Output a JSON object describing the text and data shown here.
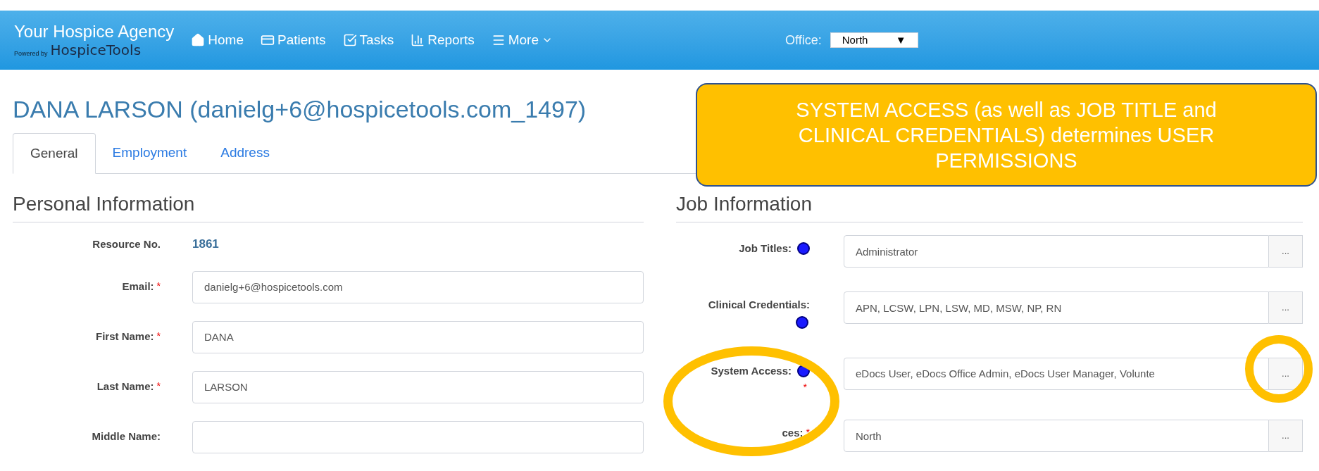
{
  "navbar": {
    "brand": "Your Hospice Agency",
    "powered_by": "Powered by",
    "logo_text": "HospiceTools",
    "items": [
      {
        "label": "Home"
      },
      {
        "label": "Patients"
      },
      {
        "label": "Tasks"
      },
      {
        "label": "Reports"
      },
      {
        "label": "More",
        "dropdown": true
      }
    ],
    "office_label": "Office:",
    "office_value": "North",
    "office_arrow": "▼"
  },
  "page_title": "DANA LARSON (danielg+6@hospicetools.com_1497)",
  "tabs": [
    {
      "label": "General",
      "selected": true
    },
    {
      "label": "Employment",
      "selected": false
    },
    {
      "label": "Address",
      "selected": false
    }
  ],
  "personal": {
    "title": "Personal Information",
    "rows": [
      {
        "kind": "text",
        "label": "Resource No.",
        "value": "1861"
      },
      {
        "kind": "input",
        "label": "Email:",
        "value": "danielg+6@hospicetools.com",
        "required_mark": "*"
      },
      {
        "kind": "input",
        "label": "First Name:",
        "value": "DANA",
        "required_mark": "*"
      },
      {
        "kind": "input",
        "label": "Last Name:",
        "value": "LARSON",
        "required_mark": "*"
      },
      {
        "kind": "input",
        "label": "Middle Name:",
        "value": ""
      }
    ]
  },
  "job": {
    "title": "Job Information",
    "rows": [
      {
        "kind": "picker",
        "label": "Job Titles:",
        "help": true,
        "value": "Administrator",
        "button": "..."
      },
      {
        "kind": "picker",
        "label": "Clinical Credentials:",
        "help": true,
        "value": "APN, LCSW, LPN, LSW, MD, MSW, NP, RN",
        "button": "..."
      },
      {
        "kind": "picker",
        "label": "System Access:",
        "help": true,
        "required_mark": "*",
        "value": "eDocs User, eDocs Office Admin, eDocs User Manager, Volunte",
        "button": "..."
      },
      {
        "kind": "picker",
        "label": "ces:",
        "help": false,
        "required_mark": "*",
        "value": "North",
        "button": "..."
      }
    ]
  },
  "callout": {
    "text": "SYSTEM ACCESS (as well as JOB TITLE and CLINICAL CREDENTIALS) determines USER PERMISSIONS"
  }
}
